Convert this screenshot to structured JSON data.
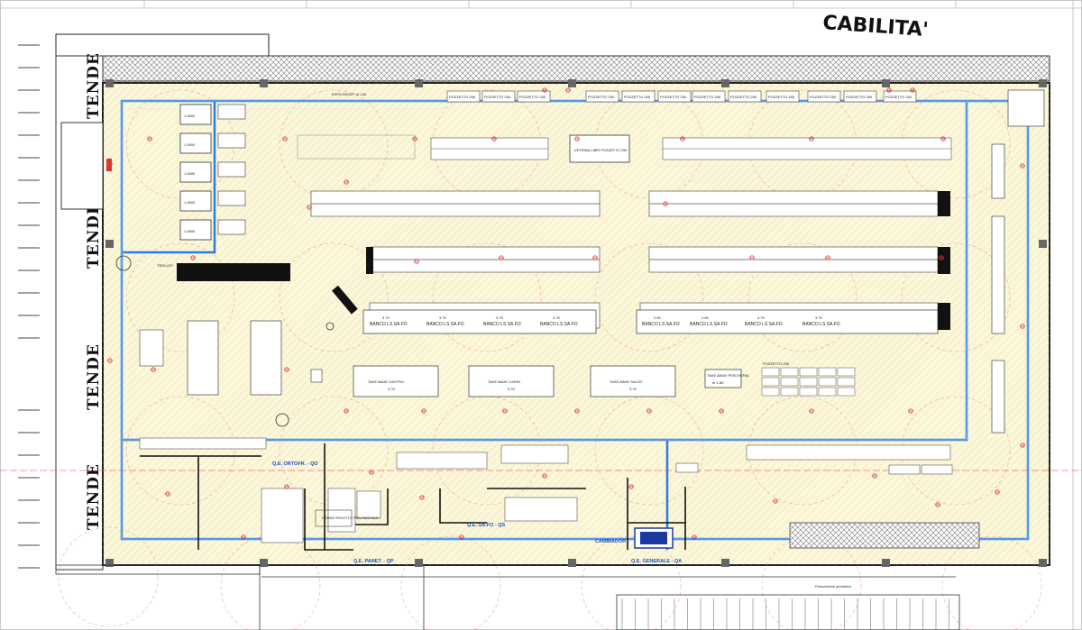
{
  "header_text": "CABILITA'",
  "side_labels": [
    "TENDE",
    "TENDE",
    "TENDE",
    "TENDE"
  ],
  "trolley_label": "TROLLEY",
  "expo_label": "EXPO IN/OUT nr 140",
  "cold_rooms": [
    "1.4500",
    "1.4500",
    "1.4500",
    "1.4500",
    "1.4500"
  ],
  "pozzetto_labels": [
    "POZZETTO 250",
    "POZZETTO 250",
    "POZZETTO 250",
    "POZZETTO 250",
    "POZZETTO 250",
    "POZZETTO 250",
    "POZZETTO 250",
    "POZZETTO 250",
    "POZZETTO 250",
    "POZZETTO 250",
    "POZZETTO 250",
    "POZZETTO 250"
  ],
  "vetrina_label": "VETRINA LIBRI POZZETTO 250",
  "banco_row_left": [
    {
      "label": "BANCO LS SA.FO",
      "size": "3.75"
    },
    {
      "label": "BANCO LS SA.FO",
      "size": "3.75"
    },
    {
      "label": "BANCO LS SA.FO",
      "size": "3.75"
    },
    {
      "label": "BANCO LS SA.FO",
      "size": "3.75"
    }
  ],
  "banco_row_right": [
    {
      "label": "BANCO LS SA.FO",
      "size": "2.50"
    },
    {
      "label": "BANCO LS SA.FO",
      "size": "2.50"
    },
    {
      "label": "BANCO LS SA.FO",
      "size": "3.75"
    },
    {
      "label": "BANCO LS SA.FO",
      "size": "3.75"
    }
  ],
  "take_away": [
    {
      "label": "TAKE AWAY GASTRO",
      "size": "3.75"
    },
    {
      "label": "TAKE AWAY CARNI",
      "size": "3.75"
    },
    {
      "label": "TAKE AWAY SALSO",
      "size": "3.75"
    },
    {
      "label": "TAKE AWAY PESCHERIA",
      "size": "nr 1.80"
    }
  ],
  "pozzetto_single": "POZZETTO 250",
  "forno_label": "FORNO RIGOTTO PER PARTNER",
  "panels": [
    {
      "label": "Q.E. ORTOFR. - QO"
    },
    {
      "label": "Q.E. SA.FO - QS"
    },
    {
      "label": "Q.E. PANET. - QP"
    },
    {
      "label": "Q.E. GENERALE - QA"
    },
    {
      "label": "CAMBIADOR"
    }
  ],
  "bottom_right_label": "Prescrizione perimetro",
  "colors": {
    "floor": "#fbf7d8",
    "hatch": "#c9c3a3",
    "duct": "#2e7be0",
    "wall": "#111111",
    "sprinkler": "#e03a3a"
  }
}
